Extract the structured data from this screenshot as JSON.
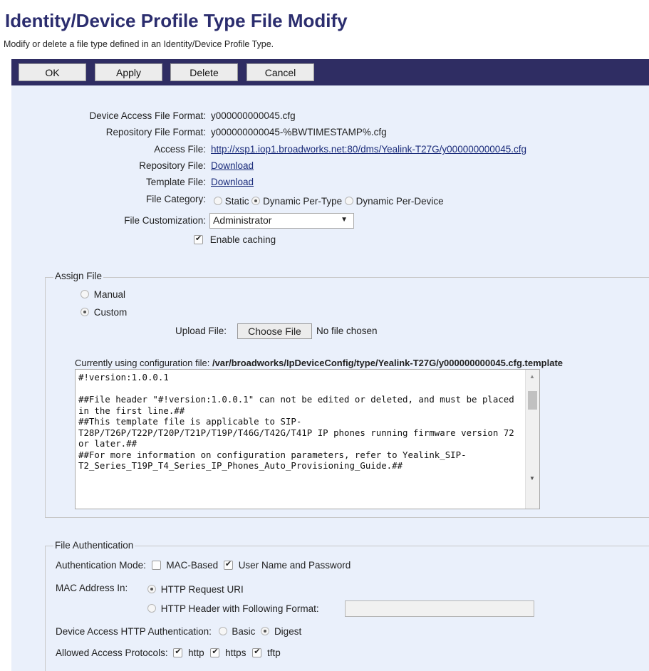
{
  "page": {
    "title": "Identity/Device Profile Type File Modify",
    "subtitle": "Modify or delete a file type defined in an Identity/Device Profile Type."
  },
  "toolbar": {
    "ok": "OK",
    "apply": "Apply",
    "delete": "Delete",
    "cancel": "Cancel"
  },
  "details": {
    "device_access_label": "Device Access File Format:",
    "device_access_value": "y000000000045.cfg",
    "repository_format_label": "Repository File Format:",
    "repository_format_value": "y000000000045-%BWTIMESTAMP%.cfg",
    "access_file_label": "Access File:",
    "access_file_value": "http://xsp1.iop1.broadworks.net:80/dms/Yealink-T27G/y000000000045.cfg",
    "repository_file_label": "Repository File:",
    "repository_file_link": "Download",
    "template_file_label": "Template File:",
    "template_file_link": "Download",
    "file_category_label": "File Category:",
    "category_static": "Static",
    "category_dynamic_type": "Dynamic Per-Type",
    "category_dynamic_device": "Dynamic Per-Device",
    "customization_label": "File Customization:",
    "customization_value": "Administrator",
    "caching_label": "Enable caching"
  },
  "assign": {
    "legend": "Assign File",
    "manual": "Manual",
    "custom": "Custom",
    "upload_label": "Upload File:",
    "choose_button": "Choose File",
    "no_file": "No file chosen",
    "current_prefix": "Currently using configuration file:",
    "current_path": "/var/broadworks/IpDeviceConfig/type/Yealink-T27G/y000000000045.cfg.template",
    "template_text": "#!version:1.0.0.1\n\n##File header \"#!version:1.0.0.1\" can not be edited or deleted, and must be placed in the first line.##\n##This template file is applicable to SIP-T28P/T26P/T22P/T20P/T21P/T19P/T46G/T42G/T41P IP phones running firmware version 72 or later.##\n##For more information on configuration parameters, refer to Yealink_SIP-T2_Series_T19P_T4_Series_IP_Phones_Auto_Provisioning_Guide.##"
  },
  "auth": {
    "legend": "File Authentication",
    "mode_label": "Authentication Mode:",
    "mac_based": "MAC-Based",
    "user_pass": "User Name and Password",
    "mac_in_label": "MAC Address In:",
    "http_uri": "HTTP Request URI",
    "http_header": "HTTP Header with Following Format:",
    "http_auth_label": "Device Access HTTP Authentication:",
    "basic": "Basic",
    "digest": "Digest",
    "protocols_label": "Allowed Access Protocols:",
    "http": "http",
    "https": "https",
    "tftp": "tftp"
  }
}
